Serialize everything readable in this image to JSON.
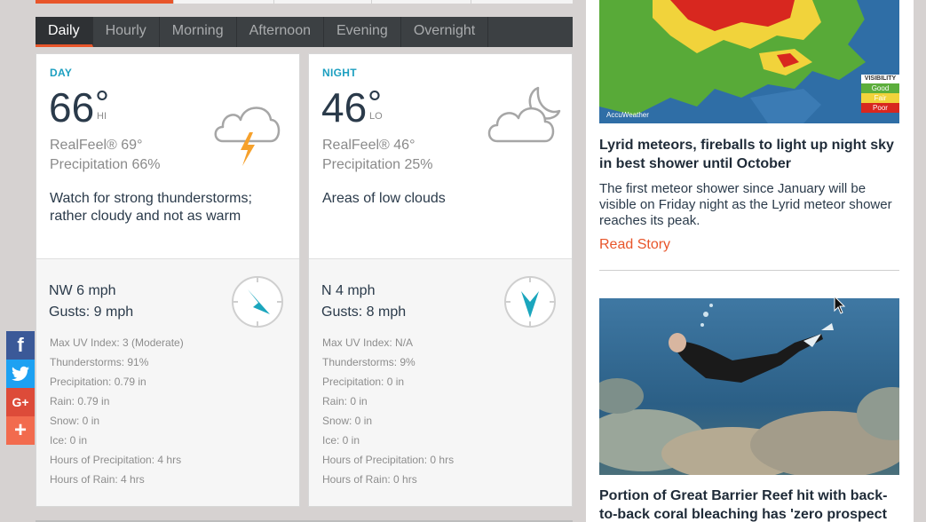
{
  "tabs": [
    {
      "label": "Daily",
      "active": true
    },
    {
      "label": "Hourly",
      "active": false
    },
    {
      "label": "Morning",
      "active": false
    },
    {
      "label": "Afternoon",
      "active": false
    },
    {
      "label": "Evening",
      "active": false
    },
    {
      "label": "Overnight",
      "active": false
    }
  ],
  "day": {
    "label": "DAY",
    "temp": "66",
    "deg": "°",
    "hilo": "HI",
    "realfeel": "RealFeel® 69°",
    "precipitation": "Precipitation 66%",
    "phrase": "Watch for strong thunderstorms; rather cloudy and not as warm",
    "icon": "thunderstorm-icon",
    "wind": "NW 6 mph",
    "gusts": "Gusts: 9 mph",
    "wind_direction": "NW",
    "details": [
      "Max UV Index: 3 (Moderate)",
      "Thunderstorms: 91%",
      "Precipitation: 0.79 in",
      "Rain: 0.79 in",
      "Snow: 0 in",
      "Ice: 0 in",
      "Hours of Precipitation: 4 hrs",
      "Hours of Rain: 4 hrs"
    ]
  },
  "night": {
    "label": "NIGHT",
    "temp": "46",
    "deg": "°",
    "hilo": "LO",
    "realfeel": "RealFeel® 46°",
    "precipitation": "Precipitation 25%",
    "phrase": "Areas of low clouds",
    "icon": "cloudy-moon-icon",
    "wind": "N 4 mph",
    "gusts": "Gusts: 8 mph",
    "wind_direction": "N",
    "details": [
      "Max UV Index: N/A",
      "Thunderstorms: 9%",
      "Precipitation: 0 in",
      "Rain: 0 in",
      "Snow: 0 in",
      "Ice: 0 in",
      "Hours of Precipitation: 0 hrs",
      "Hours of Rain: 0 hrs"
    ]
  },
  "side": {
    "map_logo": "AccuWeather",
    "legend": {
      "title": "VISIBILITY",
      "items": [
        "Good",
        "Fair",
        "Poor"
      ],
      "colors": [
        "#5cae3c",
        "#f1d33b",
        "#d8271f"
      ]
    },
    "article1": {
      "title": "Lyrid meteors, fireballs to light up night sky in best shower until October",
      "body": "The first meteor shower since January will be visible on Friday night as the Lyrid meteor shower reaches its peak.",
      "link": "Read Story"
    },
    "article2": {
      "title": "Portion of Great Barrier Reef hit with back-to-back coral bleaching has 'zero prospect"
    }
  },
  "colors": {
    "accent": "#e8552a",
    "tab_bar": "#3c4043",
    "label_blue": "#1c9fc0",
    "compass_teal": "#1ba6bd"
  }
}
